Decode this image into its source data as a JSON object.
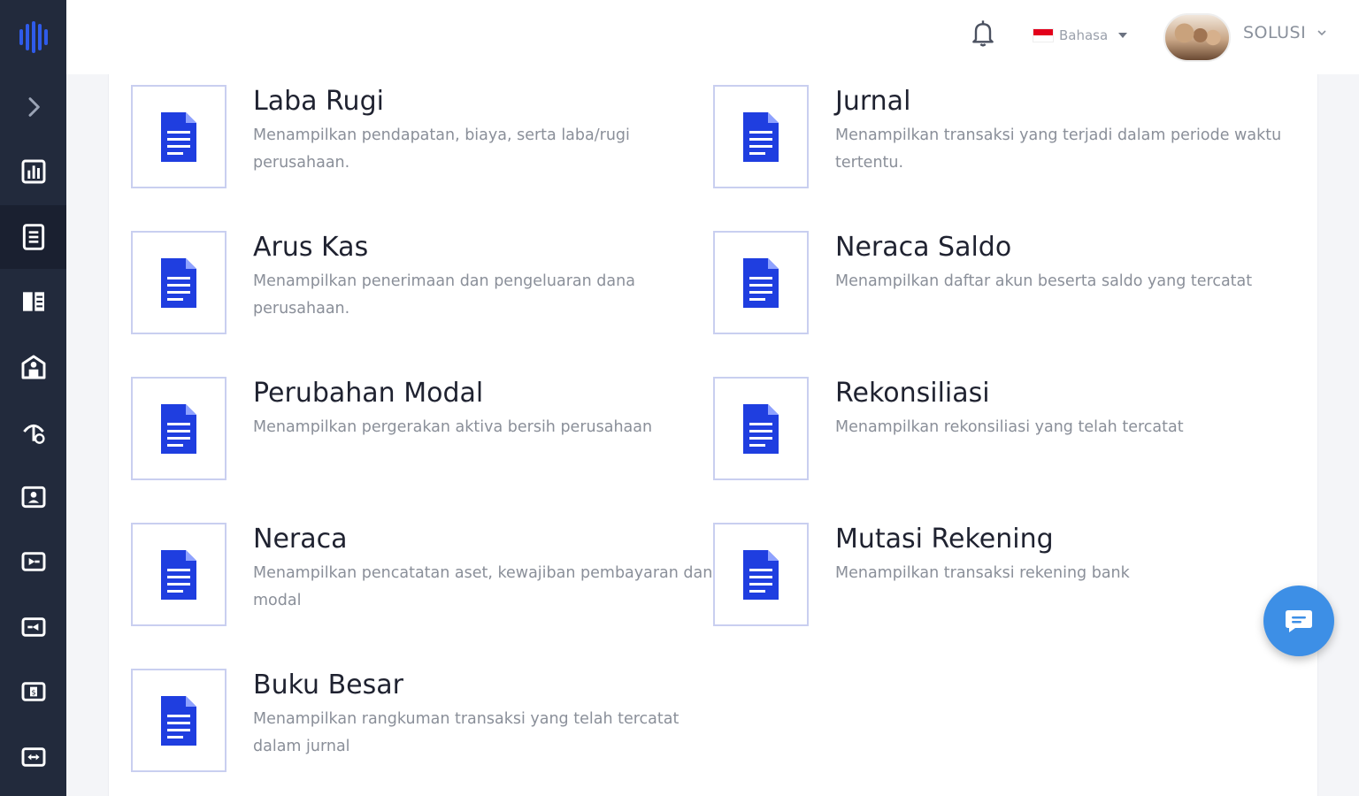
{
  "topbar": {
    "language_label": "Bahasa",
    "user_name": "SOLUSI"
  },
  "sidebar": {
    "items": [
      {
        "icon": "chevron-right-icon"
      },
      {
        "icon": "chart-icon"
      },
      {
        "icon": "document-list-icon",
        "active": true
      },
      {
        "icon": "book-icon"
      },
      {
        "icon": "building-icon"
      },
      {
        "icon": "hand-money-icon"
      },
      {
        "icon": "contact-card-icon"
      },
      {
        "icon": "import-icon"
      },
      {
        "icon": "export-icon"
      },
      {
        "icon": "cash-icon"
      },
      {
        "icon": "transfer-icon"
      }
    ]
  },
  "reports": [
    {
      "title": "Laba Rugi",
      "desc": "Menampilkan pendapatan, biaya, serta laba/rugi perusahaan."
    },
    {
      "title": "Jurnal",
      "desc": "Menampilkan transaksi yang terjadi dalam periode waktu tertentu."
    },
    {
      "title": "Arus Kas",
      "desc": "Menampilkan penerimaan dan pengeluaran dana perusahaan."
    },
    {
      "title": "Neraca Saldo",
      "desc": "Menampilkan daftar akun beserta saldo yang tercatat"
    },
    {
      "title": "Perubahan Modal",
      "desc": "Menampilkan pergerakan aktiva bersih perusahaan"
    },
    {
      "title": "Rekonsiliasi",
      "desc": "Menampilkan rekonsiliasi yang telah tercatat"
    },
    {
      "title": "Neraca",
      "desc": "Menampilkan pencatatan aset, kewajiban pembayaran dan modal"
    },
    {
      "title": "Mutasi Rekening",
      "desc": "Menampilkan transaksi rekening bank"
    },
    {
      "title": "Buku Besar",
      "desc": "Menampilkan rangkuman transaksi yang telah tercatat dalam jurnal"
    }
  ],
  "colors": {
    "sidebar_bg": "#222a3c",
    "accent_blue": "#1f3ee0",
    "fab_blue": "#3d8fe6"
  }
}
